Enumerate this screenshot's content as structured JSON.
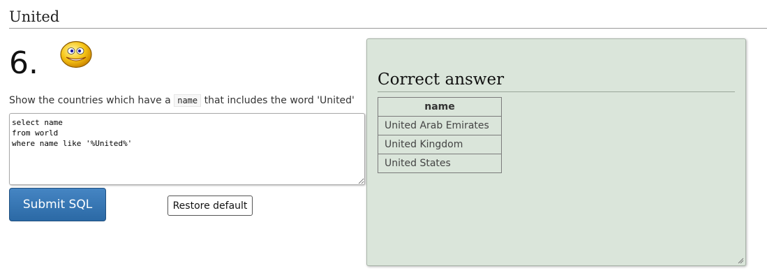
{
  "section": {
    "title": "United"
  },
  "question": {
    "number": "6.",
    "emoji": "smiley-face-icon",
    "text_before": "Show the countries which have a ",
    "code_term": "name",
    "text_after": " that includes the word 'United'"
  },
  "editor": {
    "sql": "select name\nfrom world\nwhere name like '%United%'"
  },
  "buttons": {
    "submit_label": "Submit SQL",
    "restore_label": "Restore default"
  },
  "answer": {
    "heading": "Correct answer",
    "columns": [
      "name"
    ],
    "rows": [
      "United Arab Emirates",
      "United Kingdom",
      "United States"
    ]
  },
  "colors": {
    "panel_bg": "#dae5da",
    "submit_bg": "#2b69a5"
  }
}
